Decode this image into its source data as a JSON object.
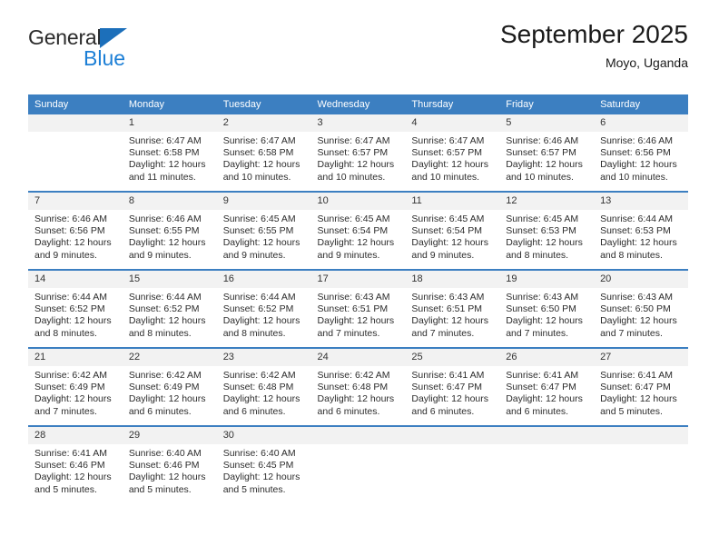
{
  "logo": {
    "word_top": "General",
    "word_bottom": "Blue",
    "triangle_icon": "triangle-icon"
  },
  "header": {
    "title": "September 2025",
    "location": "Moyo, Uganda"
  },
  "colors": {
    "header_blue": "#3c7fc1",
    "logo_blue": "#1c7fd6",
    "daynum_band": "#f2f2f2",
    "text": "#2c2c2c"
  },
  "weekday_headers": [
    "Sunday",
    "Monday",
    "Tuesday",
    "Wednesday",
    "Thursday",
    "Friday",
    "Saturday"
  ],
  "weeks": [
    [
      {
        "day": "",
        "sunrise": "",
        "sunset": "",
        "daylight1": "",
        "daylight2": ""
      },
      {
        "day": "1",
        "sunrise": "Sunrise: 6:47 AM",
        "sunset": "Sunset: 6:58 PM",
        "daylight1": "Daylight: 12 hours",
        "daylight2": "and 11 minutes."
      },
      {
        "day": "2",
        "sunrise": "Sunrise: 6:47 AM",
        "sunset": "Sunset: 6:58 PM",
        "daylight1": "Daylight: 12 hours",
        "daylight2": "and 10 minutes."
      },
      {
        "day": "3",
        "sunrise": "Sunrise: 6:47 AM",
        "sunset": "Sunset: 6:57 PM",
        "daylight1": "Daylight: 12 hours",
        "daylight2": "and 10 minutes."
      },
      {
        "day": "4",
        "sunrise": "Sunrise: 6:47 AM",
        "sunset": "Sunset: 6:57 PM",
        "daylight1": "Daylight: 12 hours",
        "daylight2": "and 10 minutes."
      },
      {
        "day": "5",
        "sunrise": "Sunrise: 6:46 AM",
        "sunset": "Sunset: 6:57 PM",
        "daylight1": "Daylight: 12 hours",
        "daylight2": "and 10 minutes."
      },
      {
        "day": "6",
        "sunrise": "Sunrise: 6:46 AM",
        "sunset": "Sunset: 6:56 PM",
        "daylight1": "Daylight: 12 hours",
        "daylight2": "and 10 minutes."
      }
    ],
    [
      {
        "day": "7",
        "sunrise": "Sunrise: 6:46 AM",
        "sunset": "Sunset: 6:56 PM",
        "daylight1": "Daylight: 12 hours",
        "daylight2": "and 9 minutes."
      },
      {
        "day": "8",
        "sunrise": "Sunrise: 6:46 AM",
        "sunset": "Sunset: 6:55 PM",
        "daylight1": "Daylight: 12 hours",
        "daylight2": "and 9 minutes."
      },
      {
        "day": "9",
        "sunrise": "Sunrise: 6:45 AM",
        "sunset": "Sunset: 6:55 PM",
        "daylight1": "Daylight: 12 hours",
        "daylight2": "and 9 minutes."
      },
      {
        "day": "10",
        "sunrise": "Sunrise: 6:45 AM",
        "sunset": "Sunset: 6:54 PM",
        "daylight1": "Daylight: 12 hours",
        "daylight2": "and 9 minutes."
      },
      {
        "day": "11",
        "sunrise": "Sunrise: 6:45 AM",
        "sunset": "Sunset: 6:54 PM",
        "daylight1": "Daylight: 12 hours",
        "daylight2": "and 9 minutes."
      },
      {
        "day": "12",
        "sunrise": "Sunrise: 6:45 AM",
        "sunset": "Sunset: 6:53 PM",
        "daylight1": "Daylight: 12 hours",
        "daylight2": "and 8 minutes."
      },
      {
        "day": "13",
        "sunrise": "Sunrise: 6:44 AM",
        "sunset": "Sunset: 6:53 PM",
        "daylight1": "Daylight: 12 hours",
        "daylight2": "and 8 minutes."
      }
    ],
    [
      {
        "day": "14",
        "sunrise": "Sunrise: 6:44 AM",
        "sunset": "Sunset: 6:52 PM",
        "daylight1": "Daylight: 12 hours",
        "daylight2": "and 8 minutes."
      },
      {
        "day": "15",
        "sunrise": "Sunrise: 6:44 AM",
        "sunset": "Sunset: 6:52 PM",
        "daylight1": "Daylight: 12 hours",
        "daylight2": "and 8 minutes."
      },
      {
        "day": "16",
        "sunrise": "Sunrise: 6:44 AM",
        "sunset": "Sunset: 6:52 PM",
        "daylight1": "Daylight: 12 hours",
        "daylight2": "and 8 minutes."
      },
      {
        "day": "17",
        "sunrise": "Sunrise: 6:43 AM",
        "sunset": "Sunset: 6:51 PM",
        "daylight1": "Daylight: 12 hours",
        "daylight2": "and 7 minutes."
      },
      {
        "day": "18",
        "sunrise": "Sunrise: 6:43 AM",
        "sunset": "Sunset: 6:51 PM",
        "daylight1": "Daylight: 12 hours",
        "daylight2": "and 7 minutes."
      },
      {
        "day": "19",
        "sunrise": "Sunrise: 6:43 AM",
        "sunset": "Sunset: 6:50 PM",
        "daylight1": "Daylight: 12 hours",
        "daylight2": "and 7 minutes."
      },
      {
        "day": "20",
        "sunrise": "Sunrise: 6:43 AM",
        "sunset": "Sunset: 6:50 PM",
        "daylight1": "Daylight: 12 hours",
        "daylight2": "and 7 minutes."
      }
    ],
    [
      {
        "day": "21",
        "sunrise": "Sunrise: 6:42 AM",
        "sunset": "Sunset: 6:49 PM",
        "daylight1": "Daylight: 12 hours",
        "daylight2": "and 7 minutes."
      },
      {
        "day": "22",
        "sunrise": "Sunrise: 6:42 AM",
        "sunset": "Sunset: 6:49 PM",
        "daylight1": "Daylight: 12 hours",
        "daylight2": "and 6 minutes."
      },
      {
        "day": "23",
        "sunrise": "Sunrise: 6:42 AM",
        "sunset": "Sunset: 6:48 PM",
        "daylight1": "Daylight: 12 hours",
        "daylight2": "and 6 minutes."
      },
      {
        "day": "24",
        "sunrise": "Sunrise: 6:42 AM",
        "sunset": "Sunset: 6:48 PM",
        "daylight1": "Daylight: 12 hours",
        "daylight2": "and 6 minutes."
      },
      {
        "day": "25",
        "sunrise": "Sunrise: 6:41 AM",
        "sunset": "Sunset: 6:47 PM",
        "daylight1": "Daylight: 12 hours",
        "daylight2": "and 6 minutes."
      },
      {
        "day": "26",
        "sunrise": "Sunrise: 6:41 AM",
        "sunset": "Sunset: 6:47 PM",
        "daylight1": "Daylight: 12 hours",
        "daylight2": "and 6 minutes."
      },
      {
        "day": "27",
        "sunrise": "Sunrise: 6:41 AM",
        "sunset": "Sunset: 6:47 PM",
        "daylight1": "Daylight: 12 hours",
        "daylight2": "and 5 minutes."
      }
    ],
    [
      {
        "day": "28",
        "sunrise": "Sunrise: 6:41 AM",
        "sunset": "Sunset: 6:46 PM",
        "daylight1": "Daylight: 12 hours",
        "daylight2": "and 5 minutes."
      },
      {
        "day": "29",
        "sunrise": "Sunrise: 6:40 AM",
        "sunset": "Sunset: 6:46 PM",
        "daylight1": "Daylight: 12 hours",
        "daylight2": "and 5 minutes."
      },
      {
        "day": "30",
        "sunrise": "Sunrise: 6:40 AM",
        "sunset": "Sunset: 6:45 PM",
        "daylight1": "Daylight: 12 hours",
        "daylight2": "and 5 minutes."
      },
      {
        "day": "",
        "sunrise": "",
        "sunset": "",
        "daylight1": "",
        "daylight2": ""
      },
      {
        "day": "",
        "sunrise": "",
        "sunset": "",
        "daylight1": "",
        "daylight2": ""
      },
      {
        "day": "",
        "sunrise": "",
        "sunset": "",
        "daylight1": "",
        "daylight2": ""
      },
      {
        "day": "",
        "sunrise": "",
        "sunset": "",
        "daylight1": "",
        "daylight2": ""
      }
    ]
  ]
}
